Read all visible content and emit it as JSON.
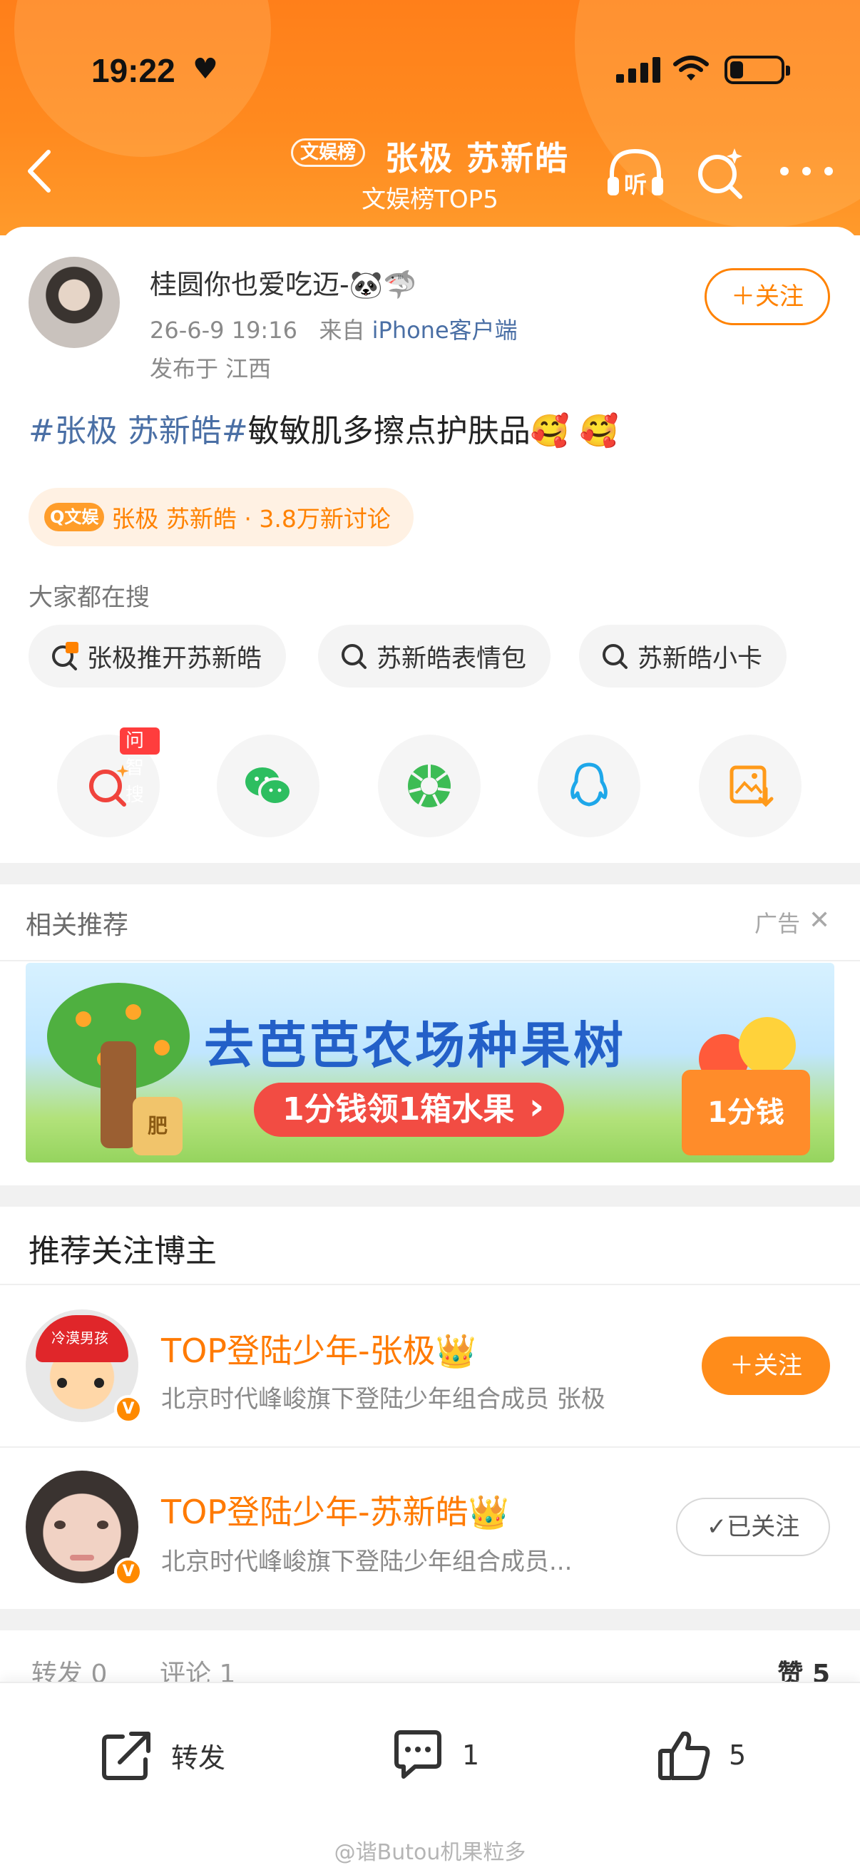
{
  "status_bar": {
    "time": "19:22",
    "heart": "♥"
  },
  "header": {
    "badge": "文娱榜",
    "title": "张极 苏新皓",
    "subtitle": "文娱榜TOP5",
    "listen_label": "听"
  },
  "post": {
    "author_name": "桂圆你也爱吃迈-🐼🦈",
    "date": "26-6-9 19:16",
    "source_prefix": "来自",
    "client": "iPhone客户端",
    "location": "发布于 江西",
    "follow_label": "＋关注",
    "hashtag": "#张极 苏新皓#",
    "body": "敏敏肌多擦点护肤品🥰 🥰"
  },
  "topic_chip": {
    "logo": "Q文娱",
    "label": "张极 苏新皓 · 3.8万新讨论"
  },
  "search_section": {
    "title": "大家都在搜",
    "items": [
      "张极推开苏新皓",
      "苏新皓表情包",
      "苏新皓小卡"
    ]
  },
  "share": {
    "ask_badge": "问智搜"
  },
  "recommend": {
    "title": "相关推荐",
    "ad_label": "广告",
    "close": "✕",
    "ad_title": "去芭芭农场种果树",
    "ad_cta": "1分钱领1箱水果",
    "ad_price": "1分钱",
    "ad_bag": "肥"
  },
  "bloggers": {
    "title": "推荐关注博主",
    "items": [
      {
        "name": "TOP登陆少年-张极👑",
        "desc": "北京时代峰峻旗下登陆少年组合成员 张极",
        "button": "＋关注",
        "followed": false,
        "cap_text": "冷漠男孩"
      },
      {
        "name": "TOP登陆少年-苏新皓👑",
        "desc": "北京时代峰峻旗下登陆少年组合成员...",
        "button": "✓已关注",
        "followed": true
      }
    ],
    "verified_mark": "V"
  },
  "stats": {
    "repost": "转发 0",
    "comment": "评论 1",
    "like": "赞 5"
  },
  "bottom_bar": {
    "repost_label": "转发",
    "comment_count": "1",
    "like_count": "5"
  },
  "watermark": "@谐Butou机果粒多",
  "colors": {
    "brand_orange": "#ff8200",
    "link_blue": "#4a6fa5",
    "header_orange": "#ff7f1a"
  }
}
